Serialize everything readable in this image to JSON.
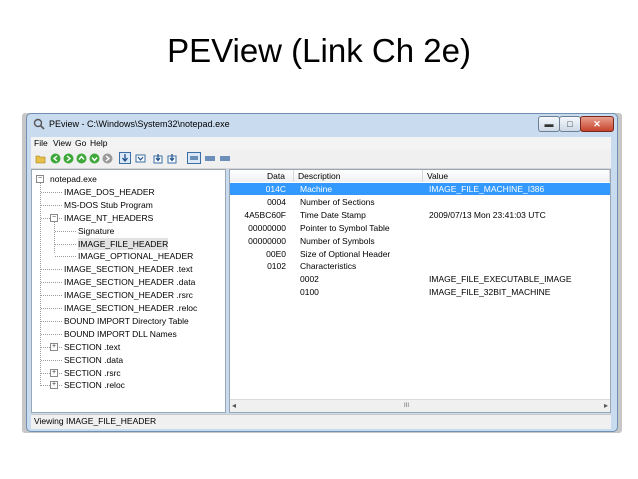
{
  "slide": {
    "title": "PEView (Link Ch 2e)"
  },
  "window": {
    "title": "PEview - C:\\Windows\\System32\\notepad.exe",
    "controls": {
      "minimize": "▬",
      "maximize": "□",
      "close": "✕"
    }
  },
  "menu": [
    "File",
    "View",
    "Go",
    "Help"
  ],
  "toolbar": {
    "icons": [
      "open-icon",
      "back-icon",
      "forward-icon",
      "up-icon",
      "next-icon",
      "refresh-icon",
      "view-byte-icon",
      "view-word-icon",
      "view-dword-icon",
      "view-qword-icon",
      "view-details-icon",
      "view-list-icon",
      "view-tree-icon"
    ]
  },
  "tree": {
    "items": [
      {
        "label": "notepad.exe",
        "depth": 0,
        "expander": "−"
      },
      {
        "label": "IMAGE_DOS_HEADER",
        "depth": 1
      },
      {
        "label": "MS-DOS Stub Program",
        "depth": 1
      },
      {
        "label": "IMAGE_NT_HEADERS",
        "depth": 1,
        "expander": "−"
      },
      {
        "label": "Signature",
        "depth": 2
      },
      {
        "label": "IMAGE_FILE_HEADER",
        "depth": 2,
        "selected": true
      },
      {
        "label": "IMAGE_OPTIONAL_HEADER",
        "depth": 2
      },
      {
        "label": "IMAGE_SECTION_HEADER .text",
        "depth": 1
      },
      {
        "label": "IMAGE_SECTION_HEADER .data",
        "depth": 1
      },
      {
        "label": "IMAGE_SECTION_HEADER .rsrc",
        "depth": 1
      },
      {
        "label": "IMAGE_SECTION_HEADER .reloc",
        "depth": 1
      },
      {
        "label": "BOUND IMPORT Directory Table",
        "depth": 1
      },
      {
        "label": "BOUND IMPORT DLL Names",
        "depth": 1
      },
      {
        "label": "SECTION .text",
        "depth": 1,
        "expander": "+"
      },
      {
        "label": "SECTION .data",
        "depth": 1
      },
      {
        "label": "SECTION .rsrc",
        "depth": 1,
        "expander": "+"
      },
      {
        "label": "SECTION .reloc",
        "depth": 1,
        "expander": "+"
      }
    ]
  },
  "grid": {
    "columns": [
      "Data",
      "Description",
      "Value"
    ],
    "rows": [
      {
        "data": "014C",
        "description": "Machine",
        "value": "IMAGE_FILE_MACHINE_I386",
        "selected": true
      },
      {
        "data": "0004",
        "description": "Number of Sections",
        "value": ""
      },
      {
        "data": "4A5BC60F",
        "description": "Time Date Stamp",
        "value": "2009/07/13 Mon 23:41:03 UTC"
      },
      {
        "data": "00000000",
        "description": "Pointer to Symbol Table",
        "value": ""
      },
      {
        "data": "00000000",
        "description": "Number of Symbols",
        "value": ""
      },
      {
        "data": "00E0",
        "description": "Size of Optional Header",
        "value": ""
      },
      {
        "data": "0102",
        "description": "Characteristics",
        "value": ""
      },
      {
        "data": "",
        "description": "0002",
        "value": "IMAGE_FILE_EXECUTABLE_IMAGE"
      },
      {
        "data": "",
        "description": "0100",
        "value": "IMAGE_FILE_32BIT_MACHINE"
      }
    ],
    "scroll": {
      "left": "◂",
      "thumb": "III",
      "right": "▸"
    }
  },
  "status": {
    "text": "Viewing IMAGE_FILE_HEADER"
  }
}
